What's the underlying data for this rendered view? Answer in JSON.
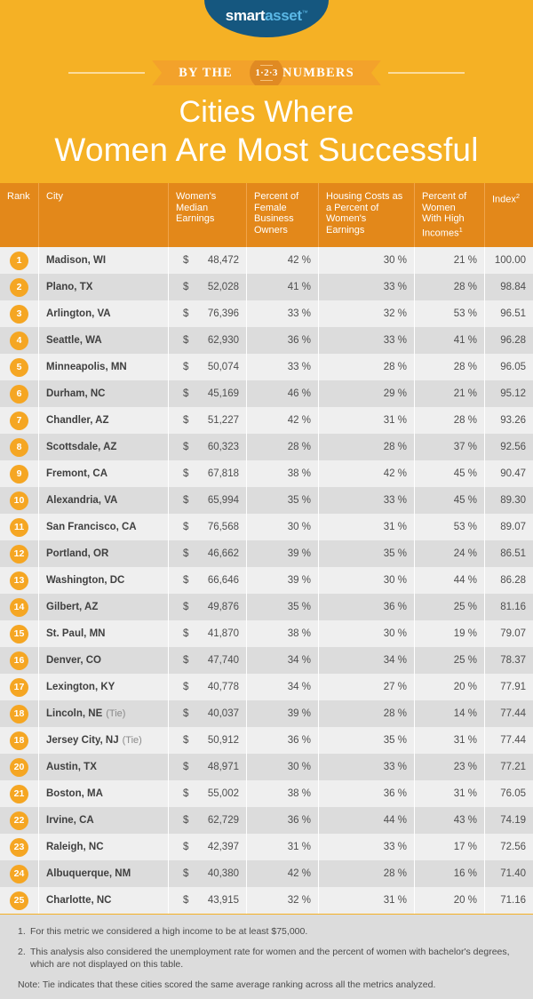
{
  "logo": {
    "part1": "smart",
    "part2": "asset",
    "tm": "™"
  },
  "ribbon": {
    "left_word": "BY THE",
    "right_word": "NUMBERS",
    "medallion_digits": "1·2·3"
  },
  "title": {
    "line1": "Cities Where",
    "line2": "Women Are Most Successful"
  },
  "colors": {
    "banner_bg": "#f5b125",
    "table_header_bg": "#e3881a",
    "badge": "#f5a623",
    "logo_navy": "#15577f",
    "logo_blue": "#5bb8e6",
    "row_odd": "#efefef",
    "row_even": "#dcdcdc"
  },
  "table": {
    "headers": [
      "Rank",
      "City",
      "Women's Median Earnings",
      "Percent of Female Business Owners",
      "Housing Costs as a Percent of Women's Earnings",
      "Percent of Women With High Incomes",
      "Index"
    ],
    "header_superscripts": {
      "percent_women_high_incomes": "1",
      "index": "2"
    },
    "currency_symbol": "$",
    "percent_symbol": "%",
    "rows": [
      {
        "rank": "1",
        "city": "Madison, WI",
        "tie": "",
        "earnings": "48,472",
        "female_business_owners": "42",
        "housing_costs": "30",
        "high_incomes": "21",
        "index": "100.00"
      },
      {
        "rank": "2",
        "city": "Plano, TX",
        "tie": "",
        "earnings": "52,028",
        "female_business_owners": "41",
        "housing_costs": "33",
        "high_incomes": "28",
        "index": "98.84"
      },
      {
        "rank": "3",
        "city": "Arlington, VA",
        "tie": "",
        "earnings": "76,396",
        "female_business_owners": "33",
        "housing_costs": "32",
        "high_incomes": "53",
        "index": "96.51"
      },
      {
        "rank": "4",
        "city": "Seattle, WA",
        "tie": "",
        "earnings": "62,930",
        "female_business_owners": "36",
        "housing_costs": "33",
        "high_incomes": "41",
        "index": "96.28"
      },
      {
        "rank": "5",
        "city": "Minneapolis, MN",
        "tie": "",
        "earnings": "50,074",
        "female_business_owners": "33",
        "housing_costs": "28",
        "high_incomes": "28",
        "index": "96.05"
      },
      {
        "rank": "6",
        "city": "Durham, NC",
        "tie": "",
        "earnings": "45,169",
        "female_business_owners": "46",
        "housing_costs": "29",
        "high_incomes": "21",
        "index": "95.12"
      },
      {
        "rank": "7",
        "city": "Chandler, AZ",
        "tie": "",
        "earnings": "51,227",
        "female_business_owners": "42",
        "housing_costs": "31",
        "high_incomes": "28",
        "index": "93.26"
      },
      {
        "rank": "8",
        "city": "Scottsdale, AZ",
        "tie": "",
        "earnings": "60,323",
        "female_business_owners": "28",
        "housing_costs": "28",
        "high_incomes": "37",
        "index": "92.56"
      },
      {
        "rank": "9",
        "city": "Fremont, CA",
        "tie": "",
        "earnings": "67,818",
        "female_business_owners": "38",
        "housing_costs": "42",
        "high_incomes": "45",
        "index": "90.47"
      },
      {
        "rank": "10",
        "city": "Alexandria, VA",
        "tie": "",
        "earnings": "65,994",
        "female_business_owners": "35",
        "housing_costs": "33",
        "high_incomes": "45",
        "index": "89.30"
      },
      {
        "rank": "11",
        "city": "San Francisco, CA",
        "tie": "",
        "earnings": "76,568",
        "female_business_owners": "30",
        "housing_costs": "31",
        "high_incomes": "53",
        "index": "89.07"
      },
      {
        "rank": "12",
        "city": "Portland, OR",
        "tie": "",
        "earnings": "46,662",
        "female_business_owners": "39",
        "housing_costs": "35",
        "high_incomes": "24",
        "index": "86.51"
      },
      {
        "rank": "13",
        "city": "Washington, DC",
        "tie": "",
        "earnings": "66,646",
        "female_business_owners": "39",
        "housing_costs": "30",
        "high_incomes": "44",
        "index": "86.28"
      },
      {
        "rank": "14",
        "city": "Gilbert, AZ",
        "tie": "",
        "earnings": "49,876",
        "female_business_owners": "35",
        "housing_costs": "36",
        "high_incomes": "25",
        "index": "81.16"
      },
      {
        "rank": "15",
        "city": "St. Paul, MN",
        "tie": "",
        "earnings": "41,870",
        "female_business_owners": "38",
        "housing_costs": "30",
        "high_incomes": "19",
        "index": "79.07"
      },
      {
        "rank": "16",
        "city": "Denver, CO",
        "tie": "",
        "earnings": "47,740",
        "female_business_owners": "34",
        "housing_costs": "34",
        "high_incomes": "25",
        "index": "78.37"
      },
      {
        "rank": "17",
        "city": "Lexington, KY",
        "tie": "",
        "earnings": "40,778",
        "female_business_owners": "34",
        "housing_costs": "27",
        "high_incomes": "20",
        "index": "77.91"
      },
      {
        "rank": "18",
        "city": "Lincoln, NE",
        "tie": "(Tie)",
        "earnings": "40,037",
        "female_business_owners": "39",
        "housing_costs": "28",
        "high_incomes": "14",
        "index": "77.44"
      },
      {
        "rank": "18",
        "city": "Jersey City, NJ",
        "tie": "(Tie)",
        "earnings": "50,912",
        "female_business_owners": "36",
        "housing_costs": "35",
        "high_incomes": "31",
        "index": "77.44"
      },
      {
        "rank": "20",
        "city": "Austin, TX",
        "tie": "",
        "earnings": "48,971",
        "female_business_owners": "30",
        "housing_costs": "33",
        "high_incomes": "23",
        "index": "77.21"
      },
      {
        "rank": "21",
        "city": "Boston, MA",
        "tie": "",
        "earnings": "55,002",
        "female_business_owners": "38",
        "housing_costs": "36",
        "high_incomes": "31",
        "index": "76.05"
      },
      {
        "rank": "22",
        "city": "Irvine, CA",
        "tie": "",
        "earnings": "62,729",
        "female_business_owners": "36",
        "housing_costs": "44",
        "high_incomes": "43",
        "index": "74.19"
      },
      {
        "rank": "23",
        "city": "Raleigh, NC",
        "tie": "",
        "earnings": "42,397",
        "female_business_owners": "31",
        "housing_costs": "33",
        "high_incomes": "17",
        "index": "72.56"
      },
      {
        "rank": "24",
        "city": "Albuquerque, NM",
        "tie": "",
        "earnings": "40,380",
        "female_business_owners": "42",
        "housing_costs": "28",
        "high_incomes": "16",
        "index": "71.40"
      },
      {
        "rank": "25",
        "city": "Charlotte, NC",
        "tie": "",
        "earnings": "43,915",
        "female_business_owners": "32",
        "housing_costs": "31",
        "high_incomes": "20",
        "index": "71.16"
      }
    ]
  },
  "footnotes": [
    {
      "marker": "1.",
      "text": "For this metric we considered a high income to be at least $75,000."
    },
    {
      "marker": "2.",
      "text": "This analysis also considered the unemployment rate for women and the percent of women with bachelor's degrees, which are not displayed on this table."
    },
    {
      "marker": "",
      "text": "Note: Tie indicates that these cities scored the same average ranking across all the metrics analyzed."
    }
  ]
}
